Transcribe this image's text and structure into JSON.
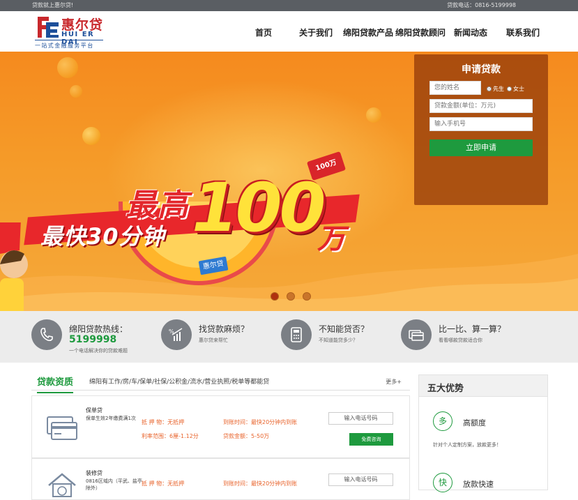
{
  "topbar": {
    "welcome": "贷款就上惠尔贷!",
    "hotline": "贷款电话：0816-5199998"
  },
  "logo": {
    "name": "惠尔贷",
    "en": "HUI ER DAI",
    "slogan": "一站式金融服务平台"
  },
  "nav": [
    "首页",
    "关于我们",
    "绵阳贷款产品",
    "绵阳贷款顾问",
    "新闻动态",
    "联系我们"
  ],
  "banner": {
    "hi": "最高",
    "fast": "最快30分钟",
    "num": "100",
    "wan": "万",
    "tag": "100万",
    "badge": "惠尔贷",
    "slide_count": 3,
    "active_slide": 1
  },
  "apply": {
    "title": "申请贷款",
    "name_placeholder": "您的姓名",
    "gender_male": "先生",
    "gender_female": "女士",
    "amount_placeholder": "贷款金额(单位：万元)",
    "phone_placeholder": "输入手机号",
    "submit": "立即申请"
  },
  "info": [
    {
      "title": "绵阳贷款热线：",
      "phone": "5199998",
      "sub": "一个电话解决你的贷款难题",
      "icon": "phone-icon"
    },
    {
      "title": "找贷款麻烦？",
      "sub": "惠尔贷来帮忙",
      "icon": "chart-icon"
    },
    {
      "title": "不知能贷否？",
      "sub": "不知道能贷多少？",
      "icon": "calculator-icon"
    },
    {
      "title": "比一比、算一算？",
      "sub": "看看哪款贷款适合你",
      "icon": "compare-icon"
    }
  ],
  "products": {
    "title": "贷款资质",
    "subtitle": "绵阳有工作/房/车/保单/社保/公积金/流水/营业执照/税单等都能贷",
    "more": "更多+",
    "items": [
      {
        "name": "保单贷",
        "desc": "保单生效2年缴费满1次",
        "collateral_label": "抵 押 物：",
        "collateral": "无抵押",
        "rate_label": "利率范围：",
        "rate": "6厘-1.12分",
        "time_label": "到账时间：",
        "time": "最快20分钟内到账",
        "amount_label": "贷款金额：",
        "amount": "5-50万",
        "phone_placeholder": "输入电话号码",
        "consult": "免费咨询"
      },
      {
        "name": "装修贷",
        "desc": "0816区域内（平武、盐亭除外）",
        "collateral_label": "抵 押 物：",
        "collateral": "无抵押",
        "time_label": "到账时间：",
        "time": "最快20分钟内到账",
        "phone_placeholder": "输入电话号码"
      }
    ]
  },
  "advantages": {
    "title": "五大优势",
    "items": [
      {
        "icon_char": "多",
        "name": "高额度",
        "desc": "针对个人定制方案，放款更多！"
      },
      {
        "icon_char": "快",
        "name": "放款快速"
      }
    ]
  }
}
